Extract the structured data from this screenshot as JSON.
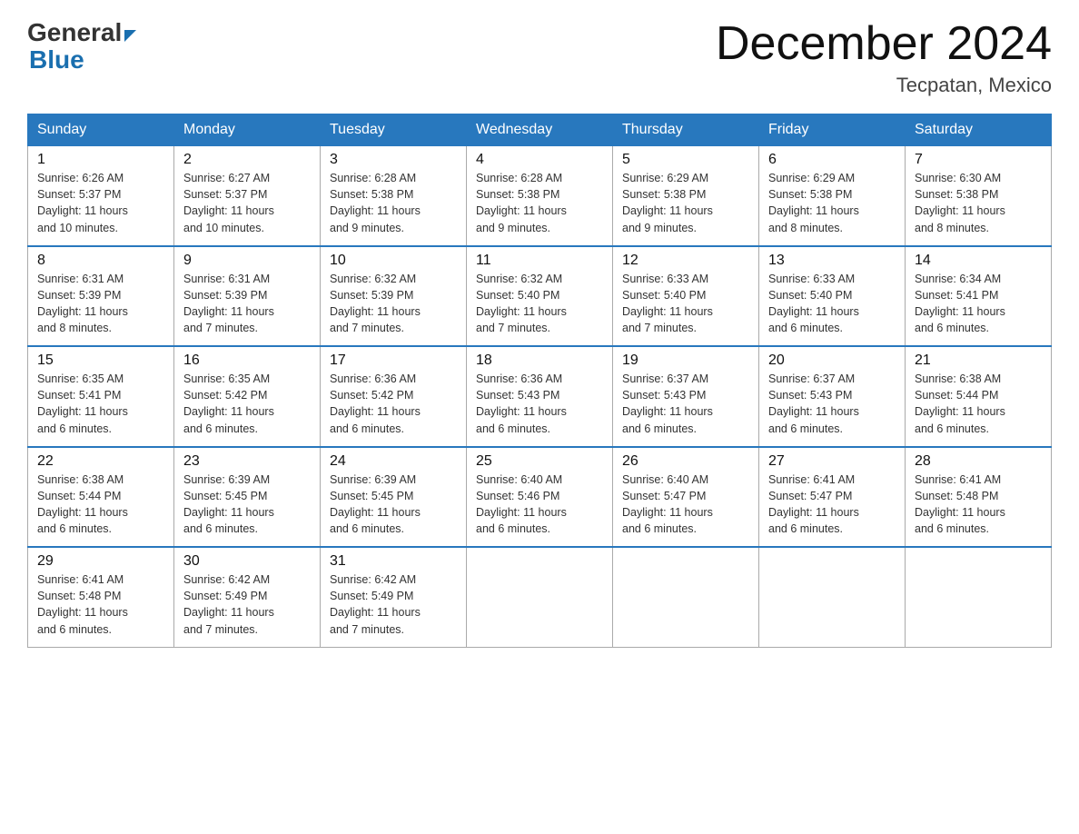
{
  "header": {
    "logo_general": "General",
    "logo_blue": "Blue",
    "month_title": "December 2024",
    "location": "Tecpatan, Mexico"
  },
  "days_of_week": [
    "Sunday",
    "Monday",
    "Tuesday",
    "Wednesday",
    "Thursday",
    "Friday",
    "Saturday"
  ],
  "weeks": [
    [
      {
        "day": "1",
        "sunrise": "6:26 AM",
        "sunset": "5:37 PM",
        "daylight": "11 hours and 10 minutes."
      },
      {
        "day": "2",
        "sunrise": "6:27 AM",
        "sunset": "5:37 PM",
        "daylight": "11 hours and 10 minutes."
      },
      {
        "day": "3",
        "sunrise": "6:28 AM",
        "sunset": "5:38 PM",
        "daylight": "11 hours and 9 minutes."
      },
      {
        "day": "4",
        "sunrise": "6:28 AM",
        "sunset": "5:38 PM",
        "daylight": "11 hours and 9 minutes."
      },
      {
        "day": "5",
        "sunrise": "6:29 AM",
        "sunset": "5:38 PM",
        "daylight": "11 hours and 9 minutes."
      },
      {
        "day": "6",
        "sunrise": "6:29 AM",
        "sunset": "5:38 PM",
        "daylight": "11 hours and 8 minutes."
      },
      {
        "day": "7",
        "sunrise": "6:30 AM",
        "sunset": "5:38 PM",
        "daylight": "11 hours and 8 minutes."
      }
    ],
    [
      {
        "day": "8",
        "sunrise": "6:31 AM",
        "sunset": "5:39 PM",
        "daylight": "11 hours and 8 minutes."
      },
      {
        "day": "9",
        "sunrise": "6:31 AM",
        "sunset": "5:39 PM",
        "daylight": "11 hours and 7 minutes."
      },
      {
        "day": "10",
        "sunrise": "6:32 AM",
        "sunset": "5:39 PM",
        "daylight": "11 hours and 7 minutes."
      },
      {
        "day": "11",
        "sunrise": "6:32 AM",
        "sunset": "5:40 PM",
        "daylight": "11 hours and 7 minutes."
      },
      {
        "day": "12",
        "sunrise": "6:33 AM",
        "sunset": "5:40 PM",
        "daylight": "11 hours and 7 minutes."
      },
      {
        "day": "13",
        "sunrise": "6:33 AM",
        "sunset": "5:40 PM",
        "daylight": "11 hours and 6 minutes."
      },
      {
        "day": "14",
        "sunrise": "6:34 AM",
        "sunset": "5:41 PM",
        "daylight": "11 hours and 6 minutes."
      }
    ],
    [
      {
        "day": "15",
        "sunrise": "6:35 AM",
        "sunset": "5:41 PM",
        "daylight": "11 hours and 6 minutes."
      },
      {
        "day": "16",
        "sunrise": "6:35 AM",
        "sunset": "5:42 PM",
        "daylight": "11 hours and 6 minutes."
      },
      {
        "day": "17",
        "sunrise": "6:36 AM",
        "sunset": "5:42 PM",
        "daylight": "11 hours and 6 minutes."
      },
      {
        "day": "18",
        "sunrise": "6:36 AM",
        "sunset": "5:43 PM",
        "daylight": "11 hours and 6 minutes."
      },
      {
        "day": "19",
        "sunrise": "6:37 AM",
        "sunset": "5:43 PM",
        "daylight": "11 hours and 6 minutes."
      },
      {
        "day": "20",
        "sunrise": "6:37 AM",
        "sunset": "5:43 PM",
        "daylight": "11 hours and 6 minutes."
      },
      {
        "day": "21",
        "sunrise": "6:38 AM",
        "sunset": "5:44 PM",
        "daylight": "11 hours and 6 minutes."
      }
    ],
    [
      {
        "day": "22",
        "sunrise": "6:38 AM",
        "sunset": "5:44 PM",
        "daylight": "11 hours and 6 minutes."
      },
      {
        "day": "23",
        "sunrise": "6:39 AM",
        "sunset": "5:45 PM",
        "daylight": "11 hours and 6 minutes."
      },
      {
        "day": "24",
        "sunrise": "6:39 AM",
        "sunset": "5:45 PM",
        "daylight": "11 hours and 6 minutes."
      },
      {
        "day": "25",
        "sunrise": "6:40 AM",
        "sunset": "5:46 PM",
        "daylight": "11 hours and 6 minutes."
      },
      {
        "day": "26",
        "sunrise": "6:40 AM",
        "sunset": "5:47 PM",
        "daylight": "11 hours and 6 minutes."
      },
      {
        "day": "27",
        "sunrise": "6:41 AM",
        "sunset": "5:47 PM",
        "daylight": "11 hours and 6 minutes."
      },
      {
        "day": "28",
        "sunrise": "6:41 AM",
        "sunset": "5:48 PM",
        "daylight": "11 hours and 6 minutes."
      }
    ],
    [
      {
        "day": "29",
        "sunrise": "6:41 AM",
        "sunset": "5:48 PM",
        "daylight": "11 hours and 6 minutes."
      },
      {
        "day": "30",
        "sunrise": "6:42 AM",
        "sunset": "5:49 PM",
        "daylight": "11 hours and 7 minutes."
      },
      {
        "day": "31",
        "sunrise": "6:42 AM",
        "sunset": "5:49 PM",
        "daylight": "11 hours and 7 minutes."
      },
      null,
      null,
      null,
      null
    ]
  ],
  "labels": {
    "sunrise": "Sunrise:",
    "sunset": "Sunset:",
    "daylight": "Daylight:"
  }
}
